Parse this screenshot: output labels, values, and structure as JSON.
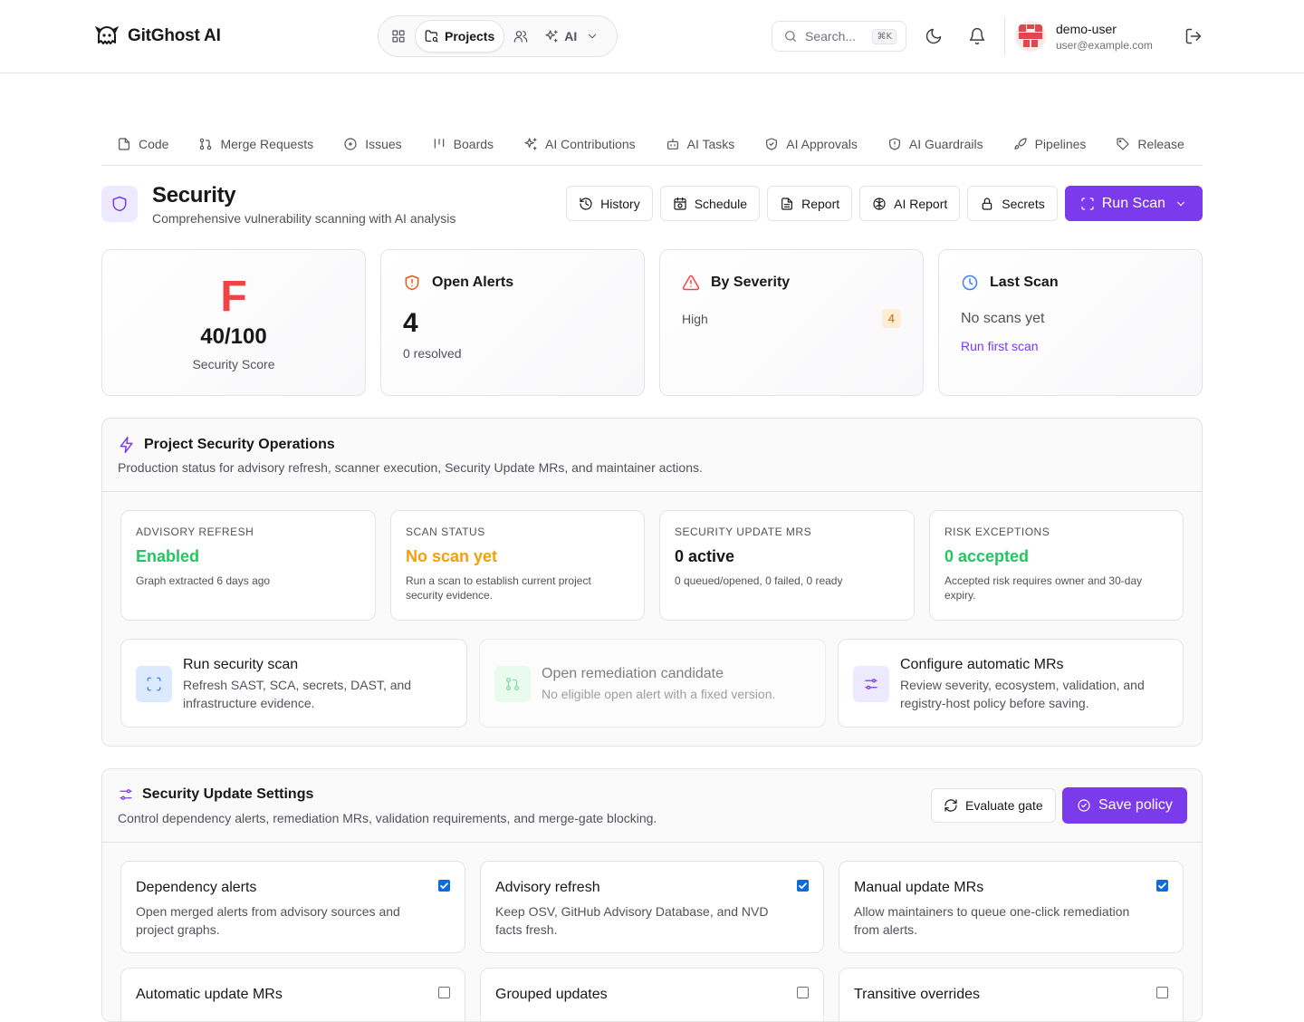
{
  "app": {
    "name": "GitGhost AI"
  },
  "nav": {
    "projects_label": "Projects",
    "ai_label": "AI"
  },
  "search": {
    "placeholder": "Search...",
    "shortcut": "⌘K"
  },
  "user": {
    "name": "demo-user",
    "email": "user@example.com"
  },
  "tabs": [
    {
      "label": "Code",
      "icon": "file-icon"
    },
    {
      "label": "Merge Requests",
      "icon": "git-pull-request-icon"
    },
    {
      "label": "Issues",
      "icon": "circle-dot-icon"
    },
    {
      "label": "Boards",
      "icon": "kanban-icon"
    },
    {
      "label": "AI Contributions",
      "icon": "sparkles-icon"
    },
    {
      "label": "AI Tasks",
      "icon": "bot-icon"
    },
    {
      "label": "AI Approvals",
      "icon": "shield-check-icon"
    },
    {
      "label": "AI Guardrails",
      "icon": "shield-alert-icon"
    },
    {
      "label": "Pipelines",
      "icon": "rocket-icon"
    },
    {
      "label": "Release",
      "icon": "tag-icon"
    }
  ],
  "page": {
    "title": "Security",
    "subtitle": "Comprehensive vulnerability scanning with AI analysis",
    "actions": {
      "history": "History",
      "schedule": "Schedule",
      "report": "Report",
      "ai_report": "AI Report",
      "secrets": "Secrets",
      "run_scan": "Run Scan"
    }
  },
  "stats": {
    "score": {
      "grade": "F",
      "value": "40/100",
      "label": "Security Score"
    },
    "alerts": {
      "title": "Open Alerts",
      "count": "4",
      "resolved": "0 resolved"
    },
    "severity": {
      "title": "By Severity",
      "level": "High",
      "count": "4"
    },
    "last_scan": {
      "title": "Last Scan",
      "status": "No scans yet",
      "link": "Run first scan"
    }
  },
  "operations": {
    "title": "Project Security Operations",
    "description": "Production status for advisory refresh, scanner execution, Security Update MRs, and maintainer actions.",
    "cards": [
      {
        "label": "Advisory refresh",
        "value": "Enabled",
        "note": "Graph extracted 6 days ago",
        "color": "#22c55e"
      },
      {
        "label": "Scan status",
        "value": "No scan yet",
        "note": "Run a scan to establish current project security evidence.",
        "color": "#f59e0b"
      },
      {
        "label": "Security Update MRs",
        "value": "0 active",
        "note": "0 queued/opened, 0 failed, 0 ready",
        "color": "#18181b"
      },
      {
        "label": "Risk exceptions",
        "value": "0 accepted",
        "note": "Accepted risk requires owner and 30-day expiry.",
        "color": "#22c55e"
      }
    ],
    "actions": [
      {
        "title": "Run security scan",
        "desc": "Refresh SAST, SCA, secrets, DAST, and infrastructure evidence."
      },
      {
        "title": "Open remediation candidate",
        "desc": "No eligible open alert with a fixed version."
      },
      {
        "title": "Configure automatic MRs",
        "desc": "Review severity, ecosystem, validation, and registry-host policy before saving."
      }
    ]
  },
  "settings": {
    "title": "Security Update Settings",
    "description": "Control dependency alerts, remediation MRs, validation requirements, and merge-gate blocking.",
    "evaluate_label": "Evaluate gate",
    "save_label": "Save policy",
    "items": [
      {
        "title": "Dependency alerts",
        "desc": "Open merged alerts from advisory sources and project graphs.",
        "checked": true
      },
      {
        "title": "Advisory refresh",
        "desc": "Keep OSV, GitHub Advisory Database, and NVD facts fresh.",
        "checked": true
      },
      {
        "title": "Manual update MRs",
        "desc": "Allow maintainers to queue one-click remediation from alerts.",
        "checked": true
      },
      {
        "title": "Automatic update MRs",
        "desc": "",
        "checked": false
      },
      {
        "title": "Grouped updates",
        "desc": "",
        "checked": false
      },
      {
        "title": "Transitive overrides",
        "desc": "",
        "checked": false
      }
    ]
  },
  "colors": {
    "accent": "#7c3aed",
    "danger": "#ef4444",
    "success": "#22c55e",
    "warning": "#f59e0b"
  }
}
